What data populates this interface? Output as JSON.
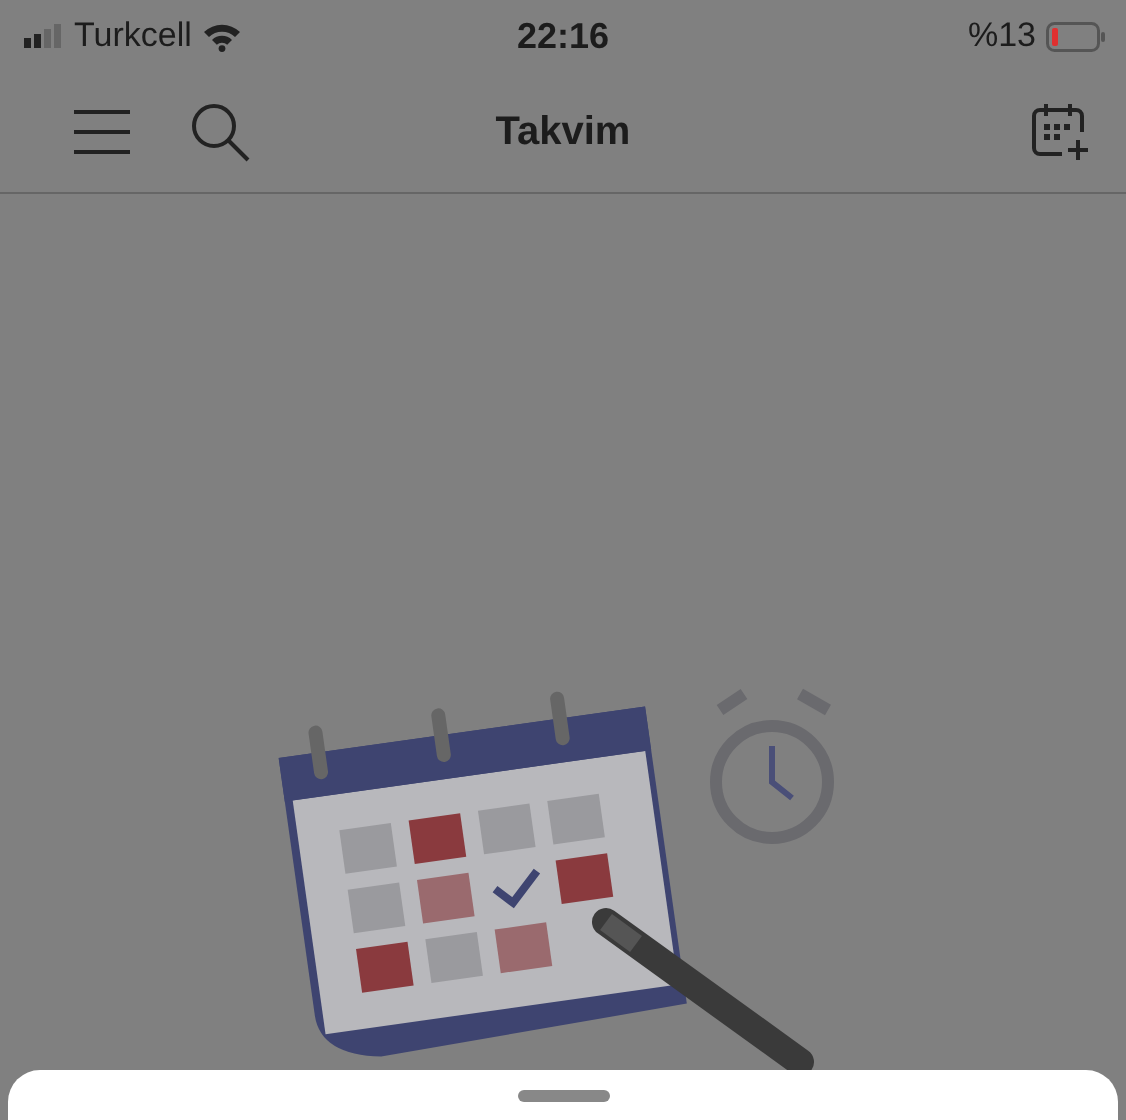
{
  "status_bar": {
    "carrier": "Turkcell",
    "time": "22:16",
    "battery": "%13"
  },
  "nav_bar": {
    "title": "Takvim"
  }
}
